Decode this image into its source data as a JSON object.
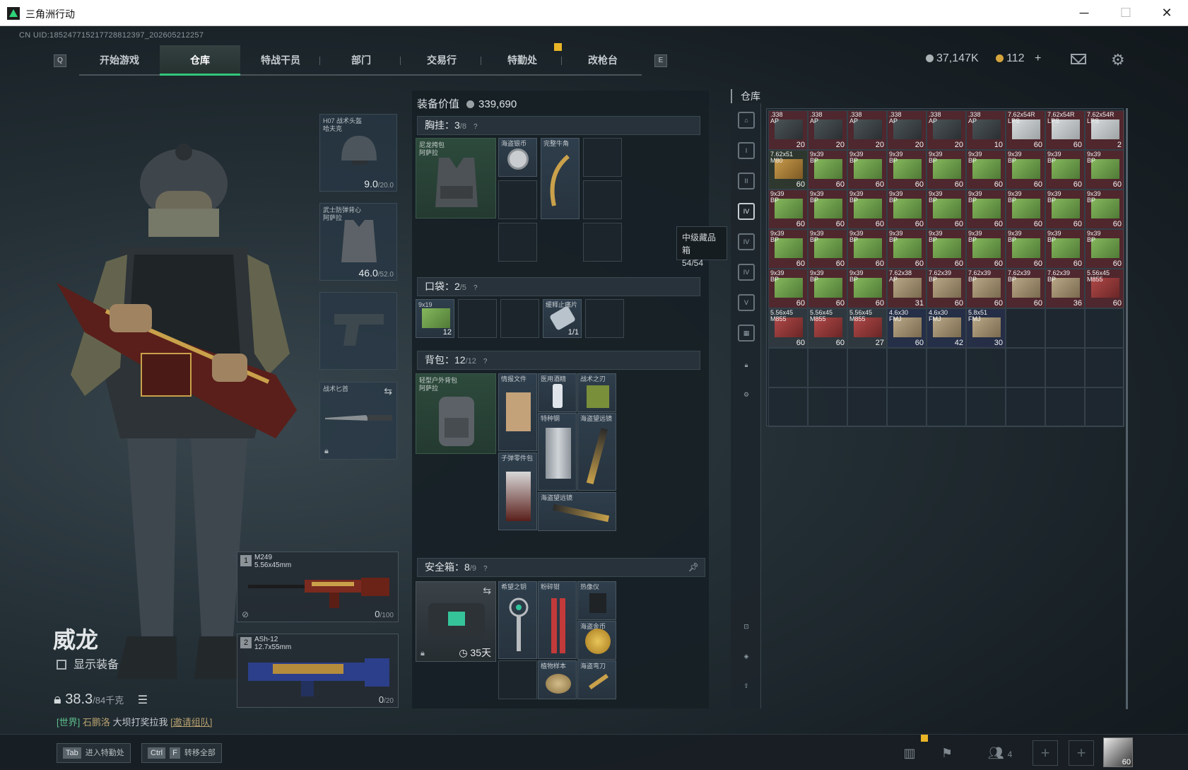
{
  "window": {
    "title": "三角洲行动",
    "controls": [
      "─",
      "☐",
      "✕"
    ]
  },
  "uid": "CN UID:18524771521772881239​7_202605212257",
  "nav": {
    "left_key": "Q",
    "right_key": "E",
    "tabs": [
      "开始游戏",
      "仓库",
      "特战干员",
      "部门",
      "交易行",
      "特勤处",
      "改枪台"
    ],
    "active": "仓库"
  },
  "currency": {
    "silver": "37,147K",
    "gold": "112",
    "plus": "+"
  },
  "character": {
    "name": "威龙",
    "show_gear_label": "显示装备",
    "weight": "38.3",
    "weight_unit": "/84千克",
    "chat": {
      "channel": "[世界]",
      "user": "石鹏洛",
      "message": "大坝打奖拉我",
      "action": "[邀请组队]"
    }
  },
  "gear": {
    "helmet": {
      "label": "H07 战术头盔\n哈夫克",
      "durability": "9.0",
      "max": "/20.0"
    },
    "armor": {
      "label": "武士防弹背心\n阿萨拉",
      "durability": "46.0",
      "max": "/52.0"
    },
    "knife": {
      "label": "战术匕首"
    },
    "weapon1": {
      "num": "1",
      "name": "M249\n5.56x45mm",
      "ammo": "0",
      "max": "/100"
    },
    "weapon2": {
      "num": "2",
      "name": "ASh-12\n12.7x55mm",
      "ammo": "0",
      "max": "/20"
    }
  },
  "equipment_value": {
    "label": "装备价值",
    "value": "339,690"
  },
  "sections": {
    "chest": {
      "title": "胸挂：",
      "count": "3",
      "cap": "/8",
      "rig": "尼龙挎包\n阿萨拉",
      "items": [
        "海盗银币",
        "完整牛角"
      ]
    },
    "pocket": {
      "title": "口袋：",
      "count": "2",
      "cap": "/5",
      "items": [
        {
          "label": "9x19",
          "cnt": "12"
        },
        {
          "label": "缓释止痛片",
          "cnt": "1/1"
        }
      ]
    },
    "backpack": {
      "title": "背包：",
      "count": "12",
      "cap": "/12",
      "bag": "轻型户外背包\n阿萨拉",
      "items": [
        "情报文件",
        "医用酒精",
        "战术之刃",
        "特种钢",
        "海盗望远镜",
        "子弹零件包",
        "海盗望远镜"
      ]
    },
    "safe": {
      "title": "安全箱：",
      "count": "8",
      "cap": "/9",
      "days": "35天",
      "items": [
        "希望之钥",
        "粉碎钳",
        "热像仪",
        "海盗金币",
        "植物样本",
        "海盗弯刀"
      ]
    }
  },
  "tooltip": {
    "title": "中级藏品箱",
    "value": "54/54"
  },
  "stash": {
    "title": "仓库",
    "rows": [
      [
        {
          "l": ".338\nAP",
          "c": "20",
          "k": "red",
          "b": "d"
        },
        {
          "l": ".338\nAP",
          "c": "20",
          "k": "red",
          "b": "d"
        },
        {
          "l": ".338\nAP",
          "c": "20",
          "k": "red",
          "b": "d"
        },
        {
          "l": ".338\nAP",
          "c": "20",
          "k": "red",
          "b": "d"
        },
        {
          "l": ".338\nAP",
          "c": "20",
          "k": "red",
          "b": "d"
        },
        {
          "l": ".338\nAP",
          "c": "10",
          "k": "red",
          "b": "d"
        },
        {
          "l": "7.62x54R\nLPS",
          "c": "60",
          "k": "red",
          "b": "w"
        },
        {
          "l": "7.62x54R\nLPS",
          "c": "60",
          "k": "red",
          "b": "w"
        },
        {
          "l": "7.62x54R\nLPS",
          "c": "2",
          "k": "red",
          "b": "w"
        }
      ],
      [
        {
          "l": "7.62x51\nM80",
          "c": "60",
          "k": "grn",
          "b": "o"
        },
        {
          "l": "9x39\nBP",
          "c": "60",
          "k": "red",
          "b": "g"
        },
        {
          "l": "9x39\nBP",
          "c": "60",
          "k": "red",
          "b": "g"
        },
        {
          "l": "9x39\nBP",
          "c": "60",
          "k": "red",
          "b": "g"
        },
        {
          "l": "9x39\nBP",
          "c": "60",
          "k": "red",
          "b": "g"
        },
        {
          "l": "9x39\nBP",
          "c": "60",
          "k": "red",
          "b": "g"
        },
        {
          "l": "9x39\nBP",
          "c": "60",
          "k": "red",
          "b": "g"
        },
        {
          "l": "9x39\nBP",
          "c": "60",
          "k": "red",
          "b": "g"
        },
        {
          "l": "9x39\nBP",
          "c": "60",
          "k": "red",
          "b": "g"
        }
      ],
      [
        {
          "l": "9x39\nBP",
          "c": "60",
          "k": "red",
          "b": "g"
        },
        {
          "l": "9x39\nBP",
          "c": "60",
          "k": "red",
          "b": "g"
        },
        {
          "l": "9x39\nBP",
          "c": "60",
          "k": "red",
          "b": "g"
        },
        {
          "l": "9x39\nBP",
          "c": "60",
          "k": "red",
          "b": "g"
        },
        {
          "l": "9x39\nBP",
          "c": "60",
          "k": "red",
          "b": "g"
        },
        {
          "l": "9x39\nBP",
          "c": "60",
          "k": "red",
          "b": "g"
        },
        {
          "l": "9x39\nBP",
          "c": "60",
          "k": "red",
          "b": "g"
        },
        {
          "l": "9x39\nBP",
          "c": "60",
          "k": "red",
          "b": "g"
        },
        {
          "l": "9x39\nBP",
          "c": "60",
          "k": "red",
          "b": "g"
        }
      ],
      [
        {
          "l": "9x39\nBP",
          "c": "60",
          "k": "red",
          "b": "g"
        },
        {
          "l": "9x39\nBP",
          "c": "60",
          "k": "red",
          "b": "g"
        },
        {
          "l": "9x39\nBP",
          "c": "60",
          "k": "red",
          "b": "g"
        },
        {
          "l": "9x39\nBP",
          "c": "60",
          "k": "red",
          "b": "g"
        },
        {
          "l": "9x39\nBP",
          "c": "60",
          "k": "red",
          "b": "g"
        },
        {
          "l": "9x39\nBP",
          "c": "60",
          "k": "red",
          "b": "g"
        },
        {
          "l": "9x39\nBP",
          "c": "60",
          "k": "red",
          "b": "g"
        },
        {
          "l": "9x39\nBP",
          "c": "60",
          "k": "red",
          "b": "g"
        },
        {
          "l": "9x39\nBP",
          "c": "60",
          "k": "red",
          "b": "g"
        }
      ],
      [
        {
          "l": "9x39\nBP",
          "c": "60",
          "k": "red",
          "b": "g"
        },
        {
          "l": "9x39\nBP",
          "c": "60",
          "k": "red",
          "b": "g"
        },
        {
          "l": "9x39\nBP",
          "c": "60",
          "k": "red",
          "b": "g"
        },
        {
          "l": "7.62x38\nAP",
          "c": "31",
          "k": "red",
          "b": "t"
        },
        {
          "l": "7.62x39\nBP",
          "c": "60",
          "k": "red",
          "b": "t"
        },
        {
          "l": "7.62x39\nBP",
          "c": "60",
          "k": "red",
          "b": "t"
        },
        {
          "l": "7.62x39\nBP",
          "c": "60",
          "k": "red",
          "b": "t"
        },
        {
          "l": "7.62x39\nBP",
          "c": "36",
          "k": "red",
          "b": "t"
        },
        {
          "l": "5.56x45\nM855",
          "c": "60",
          "k": "red",
          "b": "r"
        }
      ],
      [
        {
          "l": "5.56x45\nM855",
          "c": "60",
          "k": "gry",
          "b": "r"
        },
        {
          "l": "5.56x45\nM855",
          "c": "60",
          "k": "gry",
          "b": "r"
        },
        {
          "l": "5.56x45\nM855",
          "c": "27",
          "k": "gry",
          "b": "r"
        },
        {
          "l": "4.6x30\nFMJ",
          "c": "60",
          "k": "blu",
          "b": "t"
        },
        {
          "l": "4.6x30\nFMJ",
          "c": "42",
          "k": "blu",
          "b": "t"
        },
        {
          "l": "5.8x51\nFMJ",
          "c": "30",
          "k": "blu",
          "b": "t"
        },
        {
          "l": "",
          "c": "",
          "k": "",
          "b": ""
        },
        {
          "l": "",
          "c": "",
          "k": "",
          "b": ""
        },
        {
          "l": "",
          "c": "",
          "k": "",
          "b": ""
        }
      ]
    ]
  },
  "bottom": {
    "hint1_key": "Tab",
    "hint1": "进入特勤处",
    "hint2_key1": "Ctrl",
    "hint2_key2": "F",
    "hint2": "转移全部",
    "team_count": "4",
    "avatar_level": "60"
  }
}
